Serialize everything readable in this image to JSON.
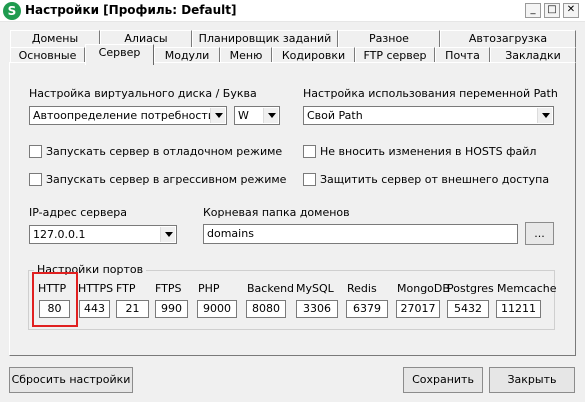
{
  "window": {
    "title": "Настройки [Профиль: Default]",
    "app_icon_letter": "S",
    "minimize": "_",
    "maximize": "□",
    "close": "✕"
  },
  "tabs_row1": [
    "Домены",
    "Алиасы",
    "Планировщик заданий",
    "Разное",
    "Автозагрузка"
  ],
  "tabs_row2": [
    "Основные",
    "Сервер",
    "Модули",
    "Меню",
    "Кодировки",
    "FTP сервер",
    "Почта",
    "Закладки"
  ],
  "active_tab": "Сервер",
  "virtual_disk": {
    "label": "Настройка виртуального диска / Буква",
    "mode_value": "Автоопределение потребности",
    "letter_value": "W"
  },
  "path_setting": {
    "label": "Настройка использования переменной Path",
    "value": "Свой Path"
  },
  "checkboxes": {
    "debug_mode": "Запускать сервер в отладочном режиме",
    "aggressive_mode": "Запускать сервер в агрессивном режиме",
    "hosts_file": "Не вносить изменения в HOSTS файл",
    "protect_external": "Защитить сервер от внешнего доступа"
  },
  "server_ip": {
    "label": "IP-адрес сервера",
    "value": "127.0.0.1"
  },
  "domains_root": {
    "label": "Корневая папка доменов",
    "value": "domains",
    "browse_label": "..."
  },
  "ports": {
    "group_title": "Настройки портов",
    "labels": [
      "HTTP",
      "HTTPS",
      "FTP",
      "FTPS",
      "PHP",
      "Backend",
      "MySQL",
      "Redis",
      "MongoDB",
      "Postgres",
      "Memcache"
    ],
    "values": [
      "80",
      "443",
      "21",
      "990",
      "9000",
      "8080",
      "3306",
      "6379",
      "27017",
      "5432",
      "11211"
    ],
    "highlight_color": "#e02020"
  },
  "buttons": {
    "reset": "Сбросить настройки",
    "save": "Сохранить",
    "close": "Закрыть"
  },
  "colors": {
    "app_icon": "#1f9b4f",
    "window_bg": "#f0f0f0"
  }
}
